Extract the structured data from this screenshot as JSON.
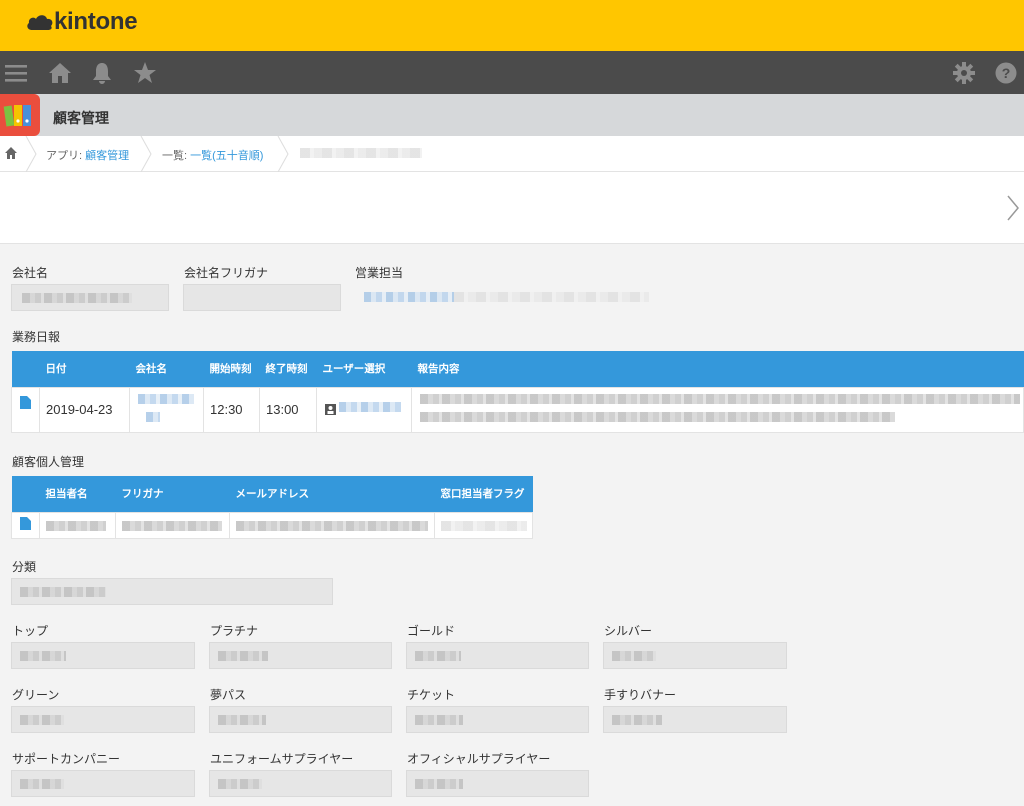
{
  "brand": {
    "logo_text": "kintone",
    "color": "#ffc600"
  },
  "nav": {
    "icons": [
      "menu-icon",
      "home-icon",
      "bell-icon",
      "star-icon",
      "gear-icon",
      "help-icon"
    ]
  },
  "app": {
    "title": "顧客管理"
  },
  "breadcrumb": {
    "app_prefix": "アプリ: ",
    "app_link": "顧客管理",
    "view_prefix": "一覧: ",
    "view_link": "一覧(五十音順)"
  },
  "fields": {
    "company_name_label": "会社名",
    "company_kana_label": "会社名フリガナ",
    "sales_rep_label": "営業担当",
    "daily_report_label": "業務日報",
    "customer_mgmt_label": "顧客個人管理",
    "category_label": "分類"
  },
  "daily_report": {
    "columns": [
      "日付",
      "会社名",
      "開始時刻",
      "終了時刻",
      "ユーザー選択",
      "報告内容"
    ],
    "rows": [
      {
        "date": "2019-04-23",
        "start": "12:30",
        "end": "13:00"
      }
    ]
  },
  "customer_table": {
    "columns": [
      "担当者名",
      "フリガナ",
      "メールアドレス",
      "窓口担当者フラグ"
    ]
  },
  "sponsors": {
    "top": "トップ",
    "platinum": "プラチナ",
    "gold": "ゴールド",
    "silver": "シルバー",
    "green": "グリーン",
    "dream_pass": "夢パス",
    "ticket": "チケット",
    "handrail_banner": "手すりバナー",
    "support_company": "サポートカンパニー",
    "uniform_supplier": "ユニフォームサプライヤー",
    "official_supplier": "オフィシャルサプライヤー"
  },
  "colors": {
    "accent": "#3498db",
    "nav": "#4b4b4b",
    "app_header": "#d6d8da",
    "app_icon": "#ea4e3d"
  }
}
